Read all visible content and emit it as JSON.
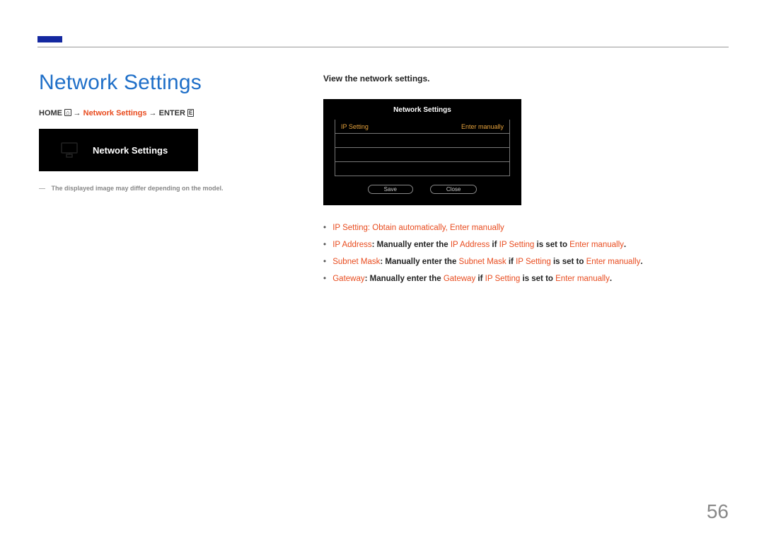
{
  "heading": "Network Settings",
  "breadcrumb": {
    "home": "HOME",
    "item": "Network Settings",
    "enter": "ENTER"
  },
  "menu_tile": {
    "label": "Network Settings"
  },
  "disclaimer": "The displayed image may differ depending on the model.",
  "right": {
    "view_title": "View the network settings.",
    "osd": {
      "title": "Network Settings",
      "row1_label": "IP Setting",
      "row1_value": "Enter manually",
      "save": "Save",
      "close": "Close"
    },
    "bullets": {
      "prefix": "•",
      "b1": {
        "t1": "IP Setting",
        "t2": ": ",
        "t3": "Obtain automatically",
        "t4": ", ",
        "t5": "Enter manually"
      },
      "b2": {
        "t1": "IP Address",
        "t2": ": Manually enter the ",
        "t3": "IP Address",
        "t4": " if ",
        "t5": "IP Setting",
        "t6": " is set to ",
        "t7": "Enter manually",
        "t8": "."
      },
      "b3": {
        "t1": "Subnet Mask",
        "t2": ": Manually enter the ",
        "t3": "Subnet Mask",
        "t4": " if ",
        "t5": "IP Setting",
        "t6": " is set to ",
        "t7": "Enter manually",
        "t8": "."
      },
      "b4": {
        "t1": "Gateway",
        "t2": ": Manually enter the ",
        "t3": "Gateway",
        "t4": " if ",
        "t5": "IP Setting",
        "t6": " is set to ",
        "t7": "Enter manually",
        "t8": "."
      }
    }
  },
  "page_number": "56"
}
